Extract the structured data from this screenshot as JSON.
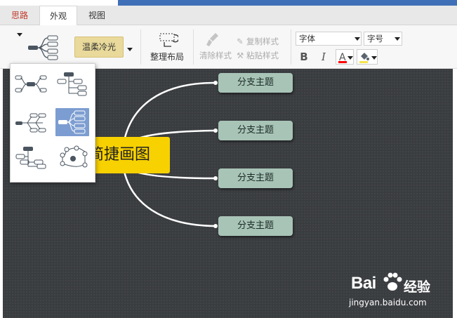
{
  "tabs": [
    {
      "label": "思路",
      "color": "#c0392b"
    },
    {
      "label": "外观",
      "active": true
    },
    {
      "label": "视图"
    }
  ],
  "ribbon": {
    "theme_label": "温柔冷光",
    "layout_button_label": "整理布局",
    "clear_style_label": "清除样式",
    "copy_style_label": "复制样式",
    "paste_style_label": "粘贴样式",
    "font_placeholder": "字体",
    "font_size_placeholder": "字号",
    "bold_label": "B",
    "italic_label": "I",
    "font_color_label": "A",
    "colors": {
      "theme_bg": "#e9d99a",
      "font_color_underline": "#ff0000",
      "fill_color_underline": "#f5e44b"
    }
  },
  "mindmap": {
    "central_topic": "简捷画图",
    "branches": [
      "分支主题",
      "分支主题",
      "分支主题",
      "分支主题"
    ],
    "colors": {
      "canvas": "#3a3d40",
      "central": "#f7d100",
      "branch": "#a8c4b7",
      "line": "#ffffff"
    }
  },
  "layout_popup": {
    "options": [
      "mind-map-both-sides",
      "org-chart-right",
      "fishbone",
      "logic-right",
      "org-chart-down",
      "radial-map"
    ],
    "selected": "logic-right"
  },
  "watermark": {
    "brand": "Bai",
    "brand_suffix": "经验",
    "url": "jingyan.baidu.com"
  }
}
